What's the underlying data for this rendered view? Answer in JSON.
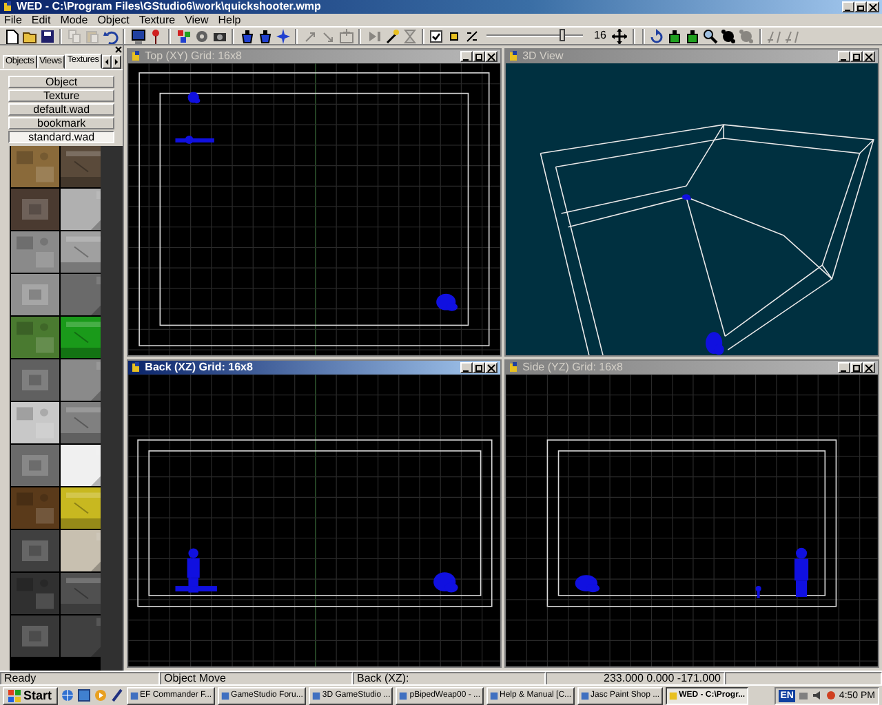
{
  "window": {
    "title": "WED - C:\\Program Files\\GStudio6\\work\\quickshooter.wmp"
  },
  "menu": [
    "File",
    "Edit",
    "Mode",
    "Object",
    "Texture",
    "View",
    "Help"
  ],
  "toolbar": [
    {
      "kind": "button",
      "disabled": false
    },
    {
      "kind": "button",
      "disabled": false
    },
    {
      "kind": "button",
      "disabled": false
    },
    {
      "kind": "separator"
    },
    {
      "kind": "button",
      "disabled": true
    },
    {
      "kind": "button",
      "disabled": true
    },
    {
      "kind": "button",
      "disabled": false
    },
    {
      "kind": "separator"
    },
    {
      "kind": "button",
      "disabled": false
    },
    {
      "kind": "button",
      "disabled": false
    },
    {
      "kind": "separator"
    },
    {
      "kind": "button",
      "disabled": false
    },
    {
      "kind": "button",
      "disabled": false
    },
    {
      "kind": "button",
      "disabled": false
    },
    {
      "kind": "separator"
    },
    {
      "kind": "button",
      "disabled": false
    },
    {
      "kind": "button",
      "disabled": false
    },
    {
      "kind": "button",
      "disabled": false
    },
    {
      "kind": "separator"
    },
    {
      "kind": "button",
      "disabled": true
    },
    {
      "kind": "button",
      "disabled": true
    },
    {
      "kind": "button",
      "disabled": true
    },
    {
      "kind": "separator"
    },
    {
      "kind": "button",
      "disabled": true
    },
    {
      "kind": "button",
      "disabled": false
    },
    {
      "kind": "button",
      "disabled": true
    },
    {
      "kind": "separator"
    },
    {
      "kind": "checkbox",
      "checked": true
    },
    {
      "kind": "button",
      "disabled": false
    },
    {
      "kind": "button",
      "disabled": false
    },
    {
      "kind": "slider",
      "level": 0.8
    },
    {
      "kind": "text",
      "text": "16"
    },
    {
      "kind": "button",
      "disabled": false
    },
    {
      "kind": "separator"
    },
    {
      "kind": "separator"
    },
    {
      "kind": "button",
      "disabled": false
    },
    {
      "kind": "button",
      "disabled": false
    },
    {
      "kind": "button",
      "disabled": false
    },
    {
      "kind": "button",
      "disabled": false
    },
    {
      "kind": "button",
      "disabled": false
    },
    {
      "kind": "button",
      "disabled": true
    },
    {
      "kind": "separator"
    },
    {
      "kind": "button",
      "disabled": true
    },
    {
      "kind": "button",
      "disabled": true
    }
  ],
  "panel": {
    "tabs": [
      {
        "label": "Objects",
        "selected": false
      },
      {
        "label": "Views",
        "selected": false
      },
      {
        "label": "Textures",
        "selected": true
      }
    ],
    "buttons": [
      {
        "label": "Object",
        "selected": false
      },
      {
        "label": "Texture",
        "selected": false
      },
      {
        "label": "default.wad",
        "selected": false
      },
      {
        "label": "bookmark",
        "selected": false
      },
      {
        "label": "standard.wad",
        "selected": true
      }
    ],
    "textures": [
      {
        "color": "#8a6a3a"
      },
      {
        "color": "#5a4a3a"
      },
      {
        "color": "#4a3a30"
      },
      {
        "color": "#b0b0b0"
      },
      {
        "color": "#8a8a8a"
      },
      {
        "color": "#a0a0a0"
      },
      {
        "color": "#909090"
      },
      {
        "color": "#6a6a6a"
      },
      {
        "color": "#4a7a30"
      },
      {
        "color": "#1a9a1a"
      },
      {
        "color": "#606060"
      },
      {
        "color": "#8a8a8a"
      },
      {
        "color": "#c8c8c8"
      },
      {
        "color": "#808080"
      },
      {
        "color": "#6a6a6a"
      },
      {
        "color": "#f0f0f0"
      },
      {
        "color": "#5a3a1a"
      },
      {
        "color": "#c8b820"
      },
      {
        "color": "#404040"
      },
      {
        "color": "#c8c0b0"
      },
      {
        "color": "#303030"
      },
      {
        "color": "#505050"
      },
      {
        "color": "#383838"
      },
      {
        "color": "#404040"
      }
    ]
  },
  "viewports": [
    {
      "title": "Top (XY) Grid: 16x8",
      "active": false,
      "kind": "top"
    },
    {
      "title": "3D View",
      "active": false,
      "kind": "perspective"
    },
    {
      "title": "Back (XZ) Grid: 16x8",
      "active": true,
      "kind": "back"
    },
    {
      "title": "Side (YZ) Grid: 16x8",
      "active": false,
      "kind": "side"
    }
  ],
  "status_bar": [
    "Ready",
    "Object Move",
    "Back (XZ):",
    "233.000 0.000 -171.000"
  ],
  "taskbar": {
    "start": "Start",
    "tasks": [
      {
        "label": "EF Commander F...",
        "selected": false
      },
      {
        "label": "GameStudio Foru...",
        "selected": false
      },
      {
        "label": "3D GameStudio ...",
        "selected": false
      },
      {
        "label": "pBipedWeap00 - ...",
        "selected": false
      },
      {
        "label": "Help & Manual [C...",
        "selected": false
      },
      {
        "label": "Jasc Paint Shop ...",
        "selected": false
      },
      {
        "label": "WED - C:\\Progr...",
        "selected": true
      }
    ],
    "language": "EN",
    "clock": "4:50 PM"
  }
}
